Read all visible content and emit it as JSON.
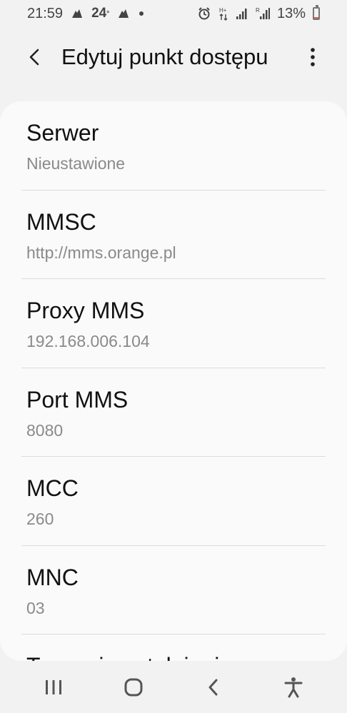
{
  "status_bar": {
    "time": "21:59",
    "battery_percent": "13%",
    "battery_level": 0.13,
    "left_icons": [
      "notification-icon",
      "temperature-badge",
      "notification-icon",
      "dot-icon"
    ],
    "temperature": "24",
    "right_icons": [
      "alarm-icon",
      "data-arrows-icon",
      "signal-icon",
      "signal-roaming-icon",
      "battery-icon"
    ]
  },
  "app_bar": {
    "title": "Edytuj punkt dostępu",
    "back_icon": "chevron-left-icon",
    "more_icon": "more-vertical-icon"
  },
  "list": {
    "items": [
      {
        "label": "Serwer",
        "value": "Nieustawione"
      },
      {
        "label": "MMSC",
        "value": "http://mms.orange.pl"
      },
      {
        "label": "Proxy MMS",
        "value": "192.168.006.104"
      },
      {
        "label": "Port MMS",
        "value": "8080"
      },
      {
        "label": "MCC",
        "value": "260"
      },
      {
        "label": "MNC",
        "value": "03"
      },
      {
        "label": "Typ uwierzytelniania",
        "value": ""
      }
    ]
  },
  "nav_bar": {
    "recents_icon": "recents-icon",
    "home_icon": "home-icon",
    "back_icon": "back-icon",
    "accessibility_icon": "accessibility-icon"
  }
}
